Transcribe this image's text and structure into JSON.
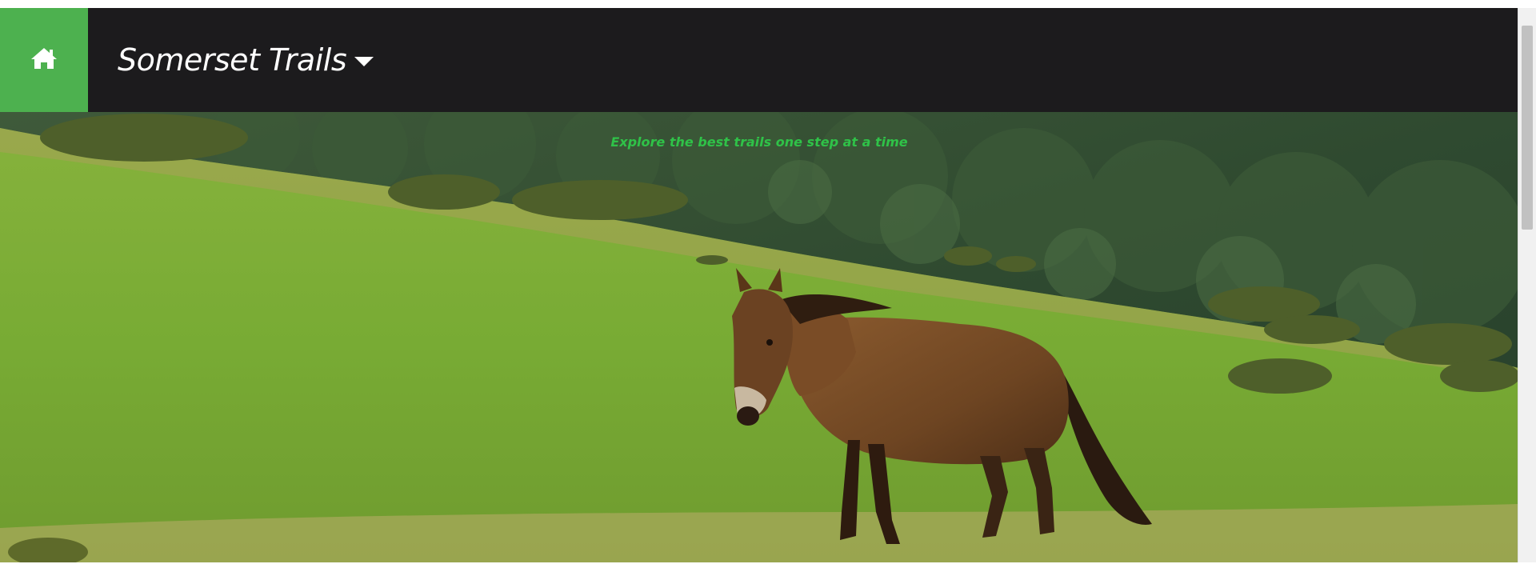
{
  "navbar": {
    "brand_title": "Somerset Trails",
    "home_icon": "home-icon",
    "dropdown_icon": "caret-down-icon",
    "accent_color": "#4db14f",
    "background_color": "#1c1b1d"
  },
  "hero": {
    "tagline": "Explore the best trails one step at a time",
    "tagline_color": "#2fc248",
    "image_description_icon": "horse-on-hillside-photo"
  }
}
